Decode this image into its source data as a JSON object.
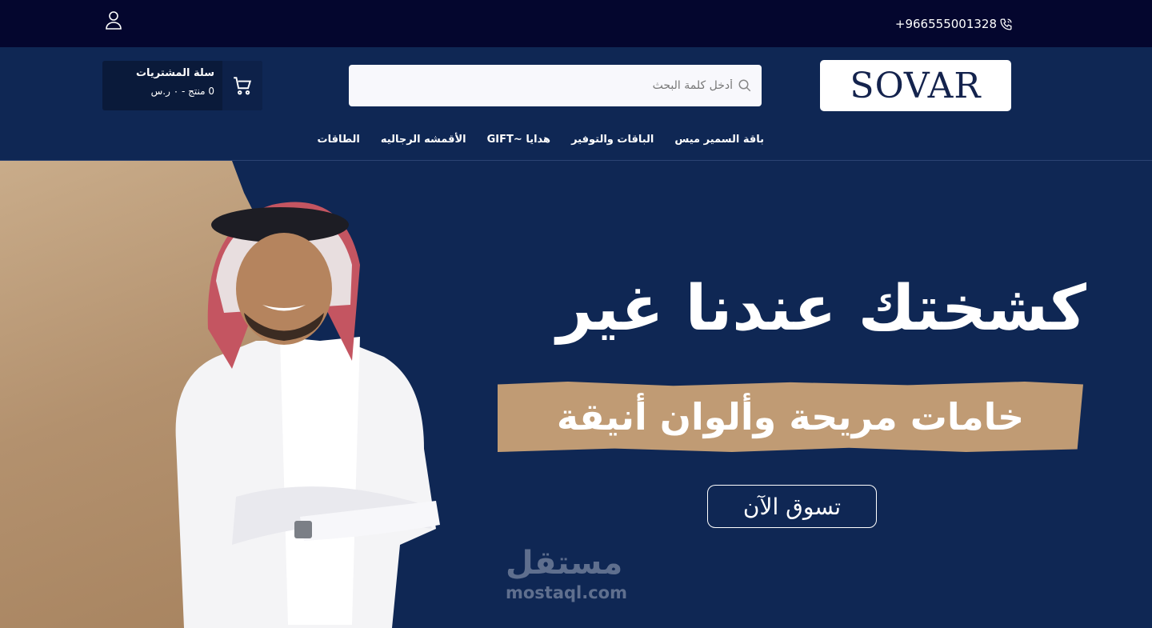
{
  "topbar": {
    "phone": "+966555001328",
    "phone_icon": "phone-icon",
    "user_icon": "user-icon"
  },
  "header": {
    "logo_text": "SOVAR",
    "search": {
      "placeholder": "أدخل كلمة البحث",
      "value": "",
      "icon": "search-icon"
    },
    "cart": {
      "title": "سلة المشتريات",
      "summary": "0 منتج - ٠ ر.س",
      "icon": "cart-icon"
    }
  },
  "nav": {
    "items": [
      {
        "label": "باقة السمير ميس"
      },
      {
        "label": "الباقات والتوفير"
      },
      {
        "label": "هدايا ~GIFT"
      },
      {
        "label": "الأقمشه الرجاليه"
      },
      {
        "label": "الطاقات"
      }
    ]
  },
  "hero": {
    "headline": "كشختك عندنا غير",
    "subheadline": "خامات مريحة وألوان أنيقة",
    "cta_label": "تسوق الآن"
  },
  "watermark": {
    "arabic": "مستقل",
    "latin": "mostaql.com"
  },
  "colors": {
    "topbar_bg": "#04062e",
    "header_bg": "#0f2754",
    "accent_tan": "#c09b74",
    "logo_text": "#14234d"
  }
}
